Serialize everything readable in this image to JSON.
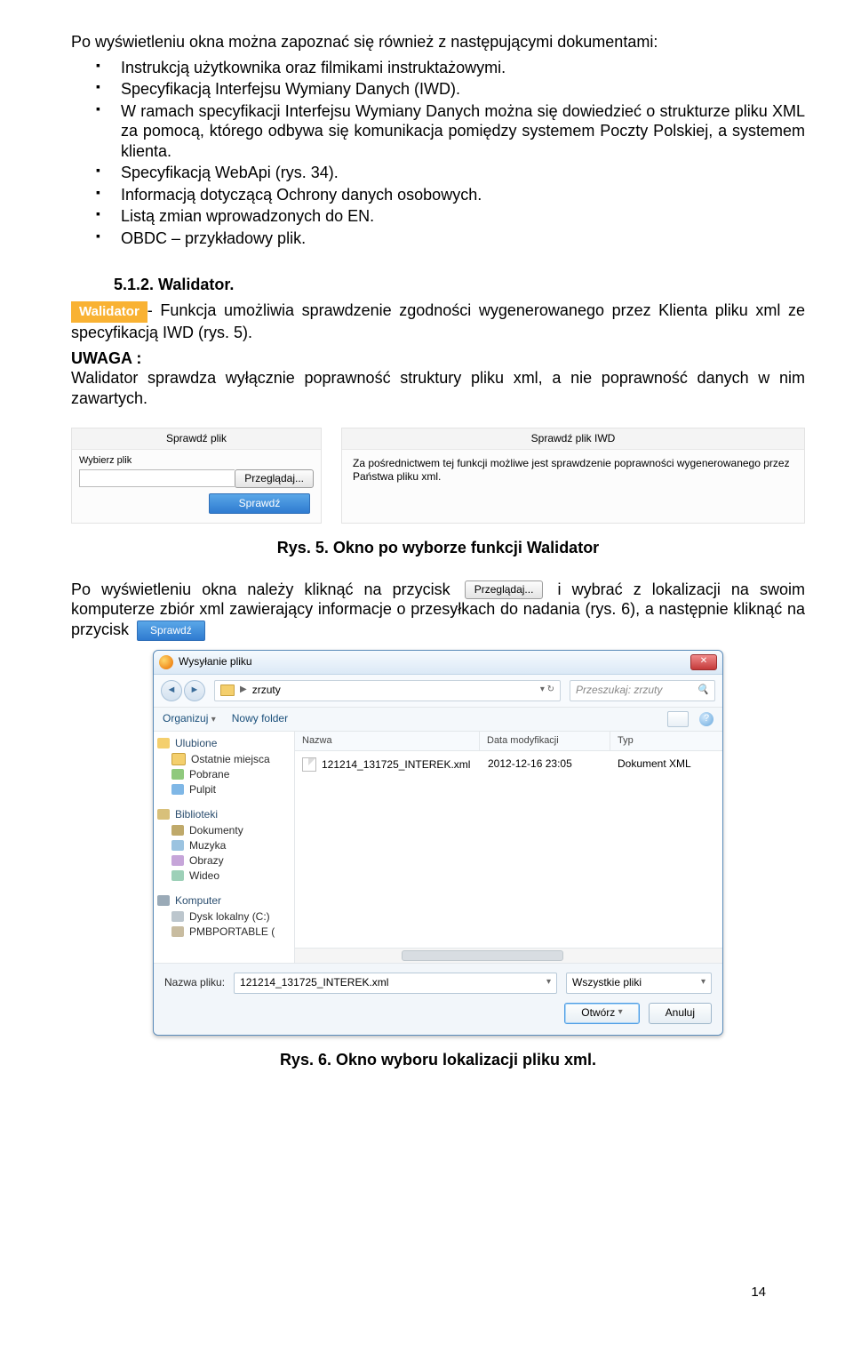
{
  "intro": "Po wyświetleniu okna można zapoznać się również z następującymi dokumentami:",
  "bullets": [
    "Instrukcją użytkownika oraz filmikami instruktażowymi.",
    "Specyfikacją Interfejsu Wymiany Danych (IWD).",
    "W ramach specyfikacji Interfejsu Wymiany Danych można się dowiedzieć o strukturze pliku XML za pomocą, którego odbywa się komunikacja pomiędzy systemem Poczty Polskiej, a systemem klienta.",
    "Specyfikacją WebApi (rys. 34).",
    "Informacją dotyczącą Ochrony danych osobowych.",
    "Listą zmian wprowadzonych do EN.",
    "OBDC – przykładowy plik."
  ],
  "section512": "5.1.2. Walidator.",
  "walidator_tag": "Walidator",
  "para_funkcja": "- Funkcja umożliwia sprawdzenie zgodności wygenerowanego przez Klienta pliku xml ze specyfikacją IWD (rys. 5).",
  "uwaga_label": "UWAGA :",
  "uwaga_text": "Walidator sprawdza wyłącznie poprawność struktury pliku xml, a nie poprawność danych w nim zawartych.",
  "caption_rys5": "Rys. 5. Okno po wyborze funkcji Walidator",
  "caption_rys6": "Rys. 6. Okno wyboru lokalizacji pliku xml.",
  "widget": {
    "left": {
      "head": "Sprawdź plik",
      "label": "Wybierz plik",
      "browse": "Przeglądaj...",
      "check": "Sprawdź"
    },
    "right": {
      "head": "Sprawdź plik IWD",
      "text": "Za pośrednictwem tej funkcji możliwe jest sprawdzenie poprawności wygenerowanego przez Państwa pliku xml."
    }
  },
  "para_after5_1": "Po wyświetleniu okna należy kliknąć na przycisk ",
  "para_after5_2": " i wybrać z lokalizacji na swoim komputerze zbiór xml zawierający informacje o przesyłkach do nadania (rys. 6), a następnie kliknąć na przycisk ",
  "btn_browse_inline": "Przeglądaj...",
  "btn_check_inline": "Sprawdź",
  "dialog": {
    "title": "Wysyłanie pliku",
    "breadcrumb": "zrzuty",
    "search_placeholder": "Przeszukaj: zrzuty",
    "organize": "Organizuj",
    "new_folder": "Nowy folder",
    "cols": {
      "name": "Nazwa",
      "date": "Data modyfikacji",
      "type": "Typ"
    },
    "file": {
      "name": "121214_131725_INTEREK.xml",
      "date": "2012-12-16 23:05",
      "type": "Dokument XML"
    },
    "sidebar": {
      "fav": "Ulubione",
      "recent": "Ostatnie miejsca",
      "downloads": "Pobrane",
      "desktop": "Pulpit",
      "libs": "Biblioteki",
      "docs": "Dokumenty",
      "music": "Muzyka",
      "pics": "Obrazy",
      "video": "Wideo",
      "computer": "Komputer",
      "cdrive": "Dysk lokalny (C:)",
      "usb": "PMBPORTABLE ("
    },
    "bottom": {
      "label": "Nazwa pliku:",
      "value": "121214_131725_INTEREK.xml",
      "filter": "Wszystkie pliki",
      "open": "Otwórz",
      "cancel": "Anuluj"
    }
  },
  "pagenum": "14"
}
